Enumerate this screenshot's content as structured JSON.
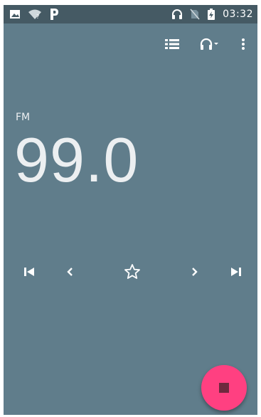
{
  "status_bar": {
    "time": "03:32",
    "icons": [
      "image-icon",
      "wifi-question-icon",
      "p-icon",
      "headset-icon",
      "no-sim-icon",
      "battery-charging-icon"
    ]
  },
  "toolbar": {
    "icons": [
      "station-list-icon",
      "headset-output-icon",
      "overflow-menu-icon"
    ]
  },
  "tuner": {
    "band": "FM",
    "frequency": "99.0"
  },
  "controls": {
    "icons": [
      "skip-previous-icon",
      "seek-down-icon",
      "favorite-star-icon",
      "seek-up-icon",
      "skip-next-icon"
    ]
  },
  "fab": {
    "icon": "stop-icon",
    "color": "#ff4081"
  },
  "colors": {
    "background": "#607d8b",
    "status_bar": "#455a64",
    "text": "#eceff1"
  }
}
